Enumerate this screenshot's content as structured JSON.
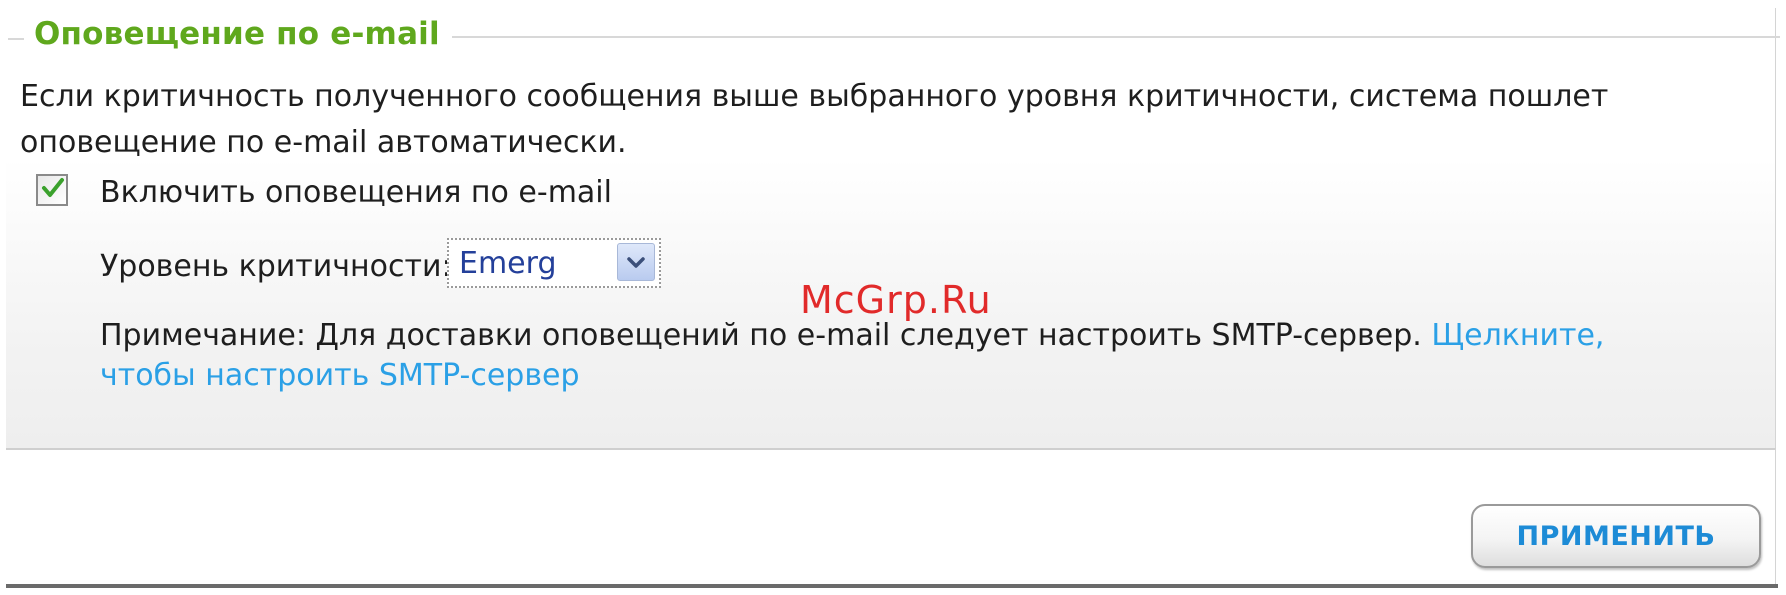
{
  "section": {
    "legend": "Оповещение по e-mail",
    "description": "Если критичность полученного сообщения выше выбранного уровня критичности, система пошлет оповещение по e-mail автоматически."
  },
  "enable_alerts": {
    "checked": true,
    "label": "Включить оповещения по e-mail"
  },
  "severity": {
    "label": "Уровень критичности:",
    "selected": "Emerg"
  },
  "note": {
    "text": "Примечание: Для доставки оповещений по e-mail следует настроить SMTP-сервер. ",
    "link": "Щелкните, чтобы настроить SMTP-сервер"
  },
  "watermark": "McGrp.Ru",
  "footer": {
    "apply_label": "ПРИМЕНИТЬ"
  },
  "colors": {
    "legend": "#5fa81d",
    "link": "#2ba0e6",
    "watermark": "#e12a2a",
    "select_text": "#24409a"
  },
  "icons": {
    "checkbox": "check-icon",
    "dropdown": "chevron-down-icon"
  }
}
